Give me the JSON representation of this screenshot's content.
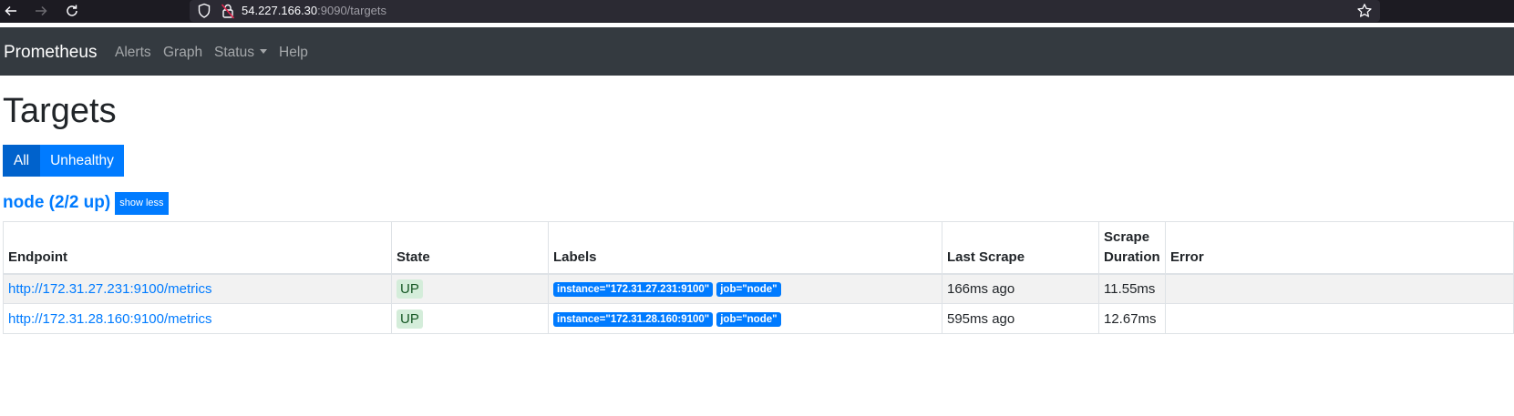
{
  "browser": {
    "url_host": "54.227.166.30",
    "url_rest": ":9090/targets",
    "icons": {
      "back": "arrow-left-icon",
      "forward": "arrow-right-icon",
      "reload": "reload-icon",
      "shield": "shield-icon",
      "insecure": "insecure-lock-icon",
      "bookmark": "star-icon"
    }
  },
  "navbar": {
    "brand": "Prometheus",
    "links": [
      "Alerts",
      "Graph",
      "Status",
      "Help"
    ]
  },
  "page": {
    "title": "Targets",
    "filters": {
      "all": "All",
      "unhealthy": "Unhealthy"
    }
  },
  "job": {
    "title": "node (2/2 up)",
    "toggle": "show less"
  },
  "table": {
    "headers": {
      "endpoint": "Endpoint",
      "state": "State",
      "labels": "Labels",
      "last_scrape": "Last Scrape",
      "scrape_duration_line1": "Scrape",
      "scrape_duration_line2": "Duration",
      "error": "Error"
    },
    "rows": [
      {
        "endpoint": "http://172.31.27.231:9100/metrics",
        "state": "UP",
        "label_instance": "instance=\"172.31.27.231:9100\"",
        "label_job": "job=\"node\"",
        "last_scrape": "166ms ago",
        "scrape_duration": "11.55ms",
        "error": ""
      },
      {
        "endpoint": "http://172.31.28.160:9100/metrics",
        "state": "UP",
        "label_instance": "instance=\"172.31.28.160:9100\"",
        "label_job": "job=\"node\"",
        "last_scrape": "595ms ago",
        "scrape_duration": "12.67ms",
        "error": ""
      }
    ]
  },
  "colors": {
    "navbar_bg": "#343a40",
    "primary": "#007bff",
    "primary_active": "#0062cc",
    "up_badge_bg": "#d4edda",
    "up_badge_text": "#155724"
  }
}
